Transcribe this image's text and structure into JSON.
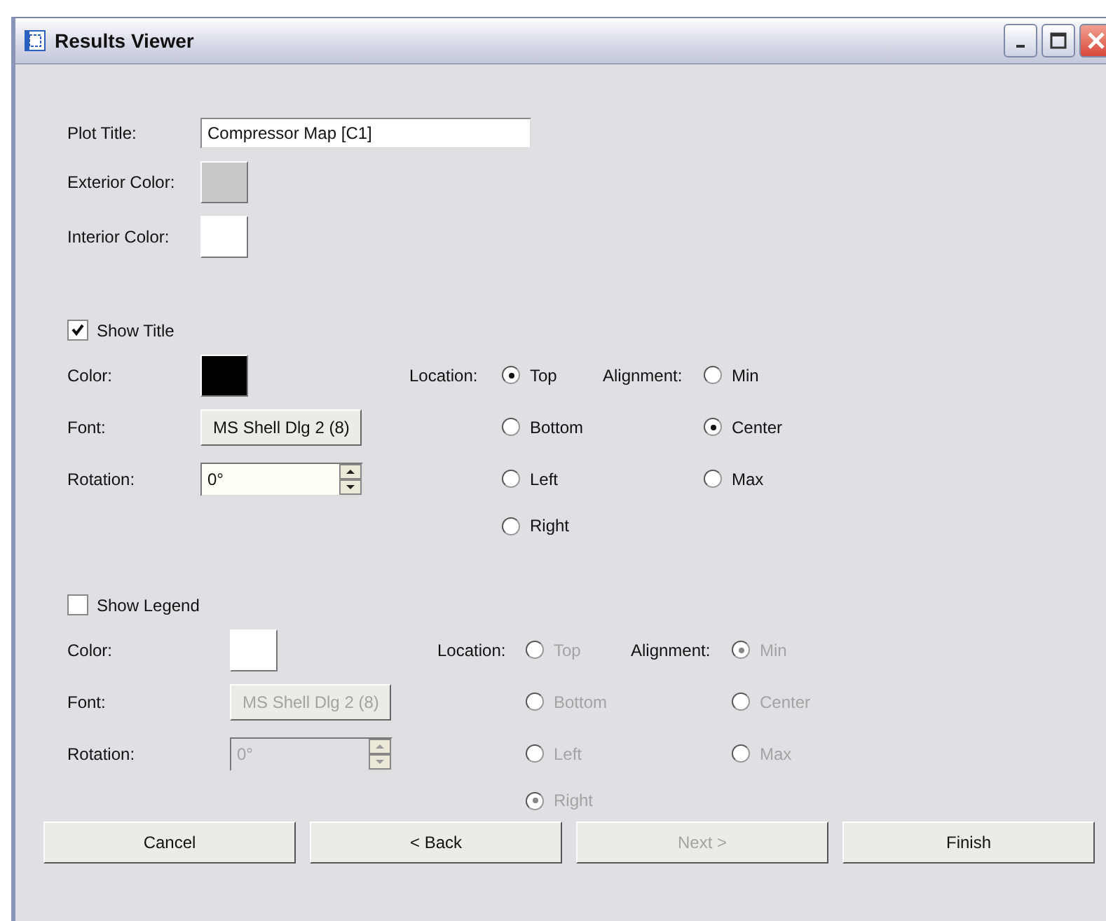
{
  "window": {
    "title": "Results Viewer"
  },
  "plot_title": {
    "label": "Plot Title:",
    "value": "Compressor Map [C1]"
  },
  "exterior_color": {
    "label": "Exterior Color:",
    "color": "#c8c8c8"
  },
  "interior_color": {
    "label": "Interior Color:",
    "color": "#ffffff"
  },
  "sections": [
    {
      "checkbox": {
        "label": "Show Title",
        "checked": true
      },
      "disabled": false,
      "color": {
        "label": "Color:",
        "color": "#000000"
      },
      "font": {
        "label": "Font:",
        "value": "MS Shell Dlg 2 (8)"
      },
      "rotation": {
        "label": "Rotation:",
        "value": "0°"
      },
      "location": {
        "label": "Location:",
        "options": [
          {
            "label": "Top",
            "selected": true
          },
          {
            "label": "Bottom",
            "selected": false
          },
          {
            "label": "Left",
            "selected": false
          },
          {
            "label": "Right",
            "selected": false
          }
        ]
      },
      "alignment": {
        "label": "Alignment:",
        "options": [
          {
            "label": "Min",
            "selected": false
          },
          {
            "label": "Center",
            "selected": true
          },
          {
            "label": "Max",
            "selected": false
          }
        ]
      }
    },
    {
      "checkbox": {
        "label": "Show Legend",
        "checked": false
      },
      "disabled": true,
      "color": {
        "label": "Color:",
        "color": "#ffffff"
      },
      "font": {
        "label": "Font:",
        "value": "MS Shell Dlg 2 (8)"
      },
      "rotation": {
        "label": "Rotation:",
        "value": "0°"
      },
      "location": {
        "label": "Location:",
        "options": [
          {
            "label": "Top",
            "selected": false
          },
          {
            "label": "Bottom",
            "selected": false
          },
          {
            "label": "Left",
            "selected": false
          },
          {
            "label": "Right",
            "selected": true
          }
        ]
      },
      "alignment": {
        "label": "Alignment:",
        "options": [
          {
            "label": "Min",
            "selected": true
          },
          {
            "label": "Center",
            "selected": false
          },
          {
            "label": "Max",
            "selected": false
          }
        ]
      }
    }
  ],
  "buttons": [
    {
      "label": "Cancel",
      "disabled": false
    },
    {
      "label": "< Back",
      "disabled": false
    },
    {
      "label": "Next >",
      "disabled": true
    },
    {
      "label": "Finish",
      "disabled": false
    }
  ]
}
